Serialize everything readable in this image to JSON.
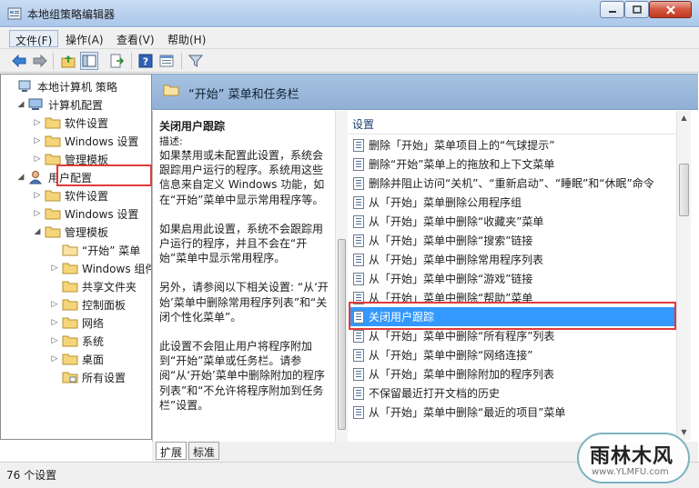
{
  "window": {
    "title": "本地组策略编辑器"
  },
  "menu": [
    {
      "label": "文件(F)"
    },
    {
      "label": "操作(A)"
    },
    {
      "label": "查看(V)"
    },
    {
      "label": "帮助(H)"
    }
  ],
  "toolbar": {
    "icons": [
      "back-arrow-icon",
      "forward-arrow-icon",
      "folder-up-icon",
      "show-hide-tree-icon",
      "export-list-icon",
      "help-icon",
      "properties-icon",
      "filter-icon"
    ]
  },
  "tree": {
    "root": "本地计算机 策略",
    "computer_config": "计算机配置",
    "computer_children": [
      "软件设置",
      "Windows 设置",
      "管理模板"
    ],
    "user_config": "用户配置",
    "user_children": [
      "软件设置",
      "Windows 设置",
      "管理模板"
    ],
    "admin_children": [
      "“开始” 菜单",
      "Windows 组件",
      "共享文件夹",
      "控制面板",
      "网络",
      "系统",
      "桌面",
      "所有设置"
    ]
  },
  "tabs": [
    "扩展",
    "标准"
  ],
  "header": {
    "title": "“开始” 菜单和任务栏"
  },
  "description": {
    "title": "关闭用户跟踪",
    "label": "描述:",
    "paragraphs": [
      "如果禁用或未配置此设置，系统会跟踪用户运行的程序。系统用这些信息来自定义 Windows 功能，如在“开始”菜单中显示常用程序等。",
      "如果启用此设置，系统不会跟踪用户运行的程序，并且不会在“开始”菜单中显示常用程序。",
      "另外，请参阅以下相关设置: “从‘开始’菜单中删除常用程序列表”和“关闭个性化菜单”。",
      "此设置不会阻止用户将程序附加到“开始”菜单或任务栏。请参阅“从‘开始’菜单中删除附加的程序列表”和“不允许将程序附加到任务栏”设置。"
    ]
  },
  "settings": {
    "column_header": "设置",
    "items": [
      "删除「开始」菜单项目上的“气球提示”",
      "删除“开始”菜单上的拖放和上下文菜单",
      "删除并阻止访问“关机”、“重新启动”、“睡眠”和“休眠”命令",
      "从「开始」菜单删除公用程序组",
      "从「开始」菜单中删除“收藏夹”菜单",
      "从「开始」菜单中删除“搜索”链接",
      "从「开始」菜单中删除常用程序列表",
      "从「开始」菜单中删除“游戏”链接",
      "从「开始」菜单中删除“帮助”菜单",
      "关闭用户跟踪",
      "从「开始」菜单中删除“所有程序”列表",
      "从「开始」菜单中删除“网络连接”",
      "从「开始」菜单中删除附加的程序列表",
      "不保留最近打开文档的历史",
      "从「开始」菜单中删除“最近的项目”菜单"
    ],
    "selected_index": 9
  },
  "status": {
    "text": "76 个设置"
  },
  "watermark": {
    "line1": "雨林木风",
    "line2": "www.YLMFU.com"
  },
  "colors": {
    "selection": "#3399ff",
    "highlight_box": "#e23a3a",
    "header_band": "#9bbadf"
  }
}
